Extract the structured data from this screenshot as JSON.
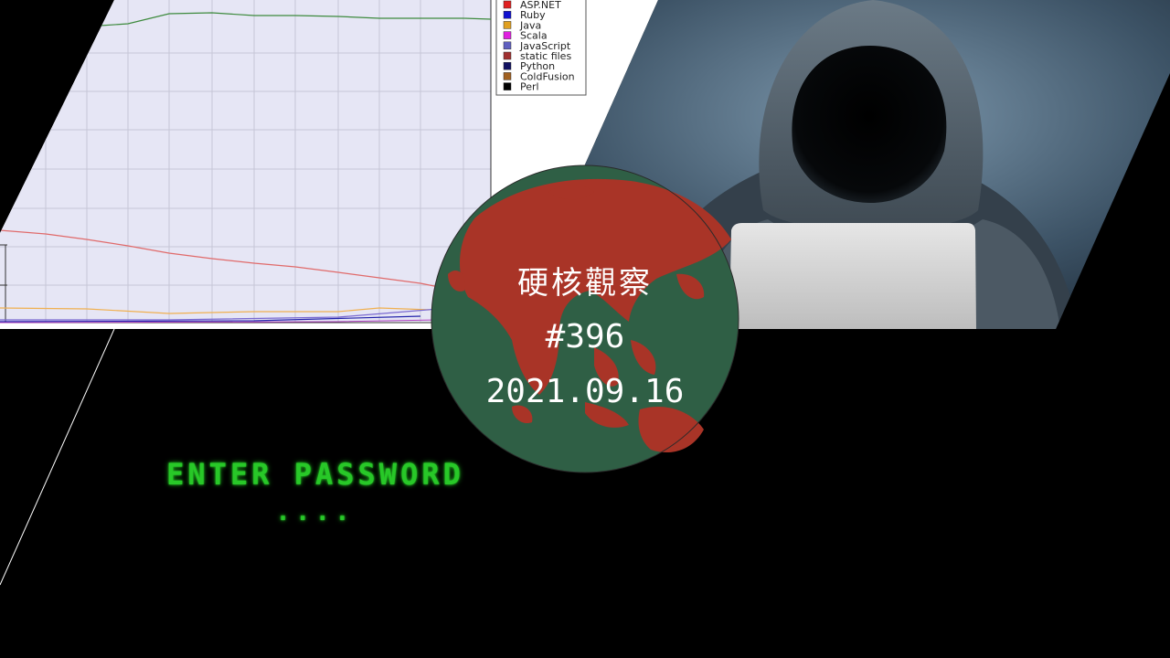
{
  "chart_panel": {
    "legend": [
      "ASP.NET",
      "Ruby",
      "Java",
      "Scala",
      "JavaScript",
      "static files",
      "Python",
      "ColdFusion",
      "Perl"
    ],
    "legend_colors": [
      "#e02020",
      "#1010d0",
      "#e0a020",
      "#e020e0",
      "#6060c0",
      "#a03030",
      "#101060",
      "#a06020",
      "#000000"
    ]
  },
  "badge": {
    "title": "硬核觀察",
    "issue": "#396",
    "date": "2021.09.16",
    "colors": {
      "land": "#a93427",
      "sea": "#2f5f45"
    }
  },
  "terminal": {
    "prompt": "ENTER PASSWORD",
    "masked": "....",
    "color": "#28c828"
  }
}
